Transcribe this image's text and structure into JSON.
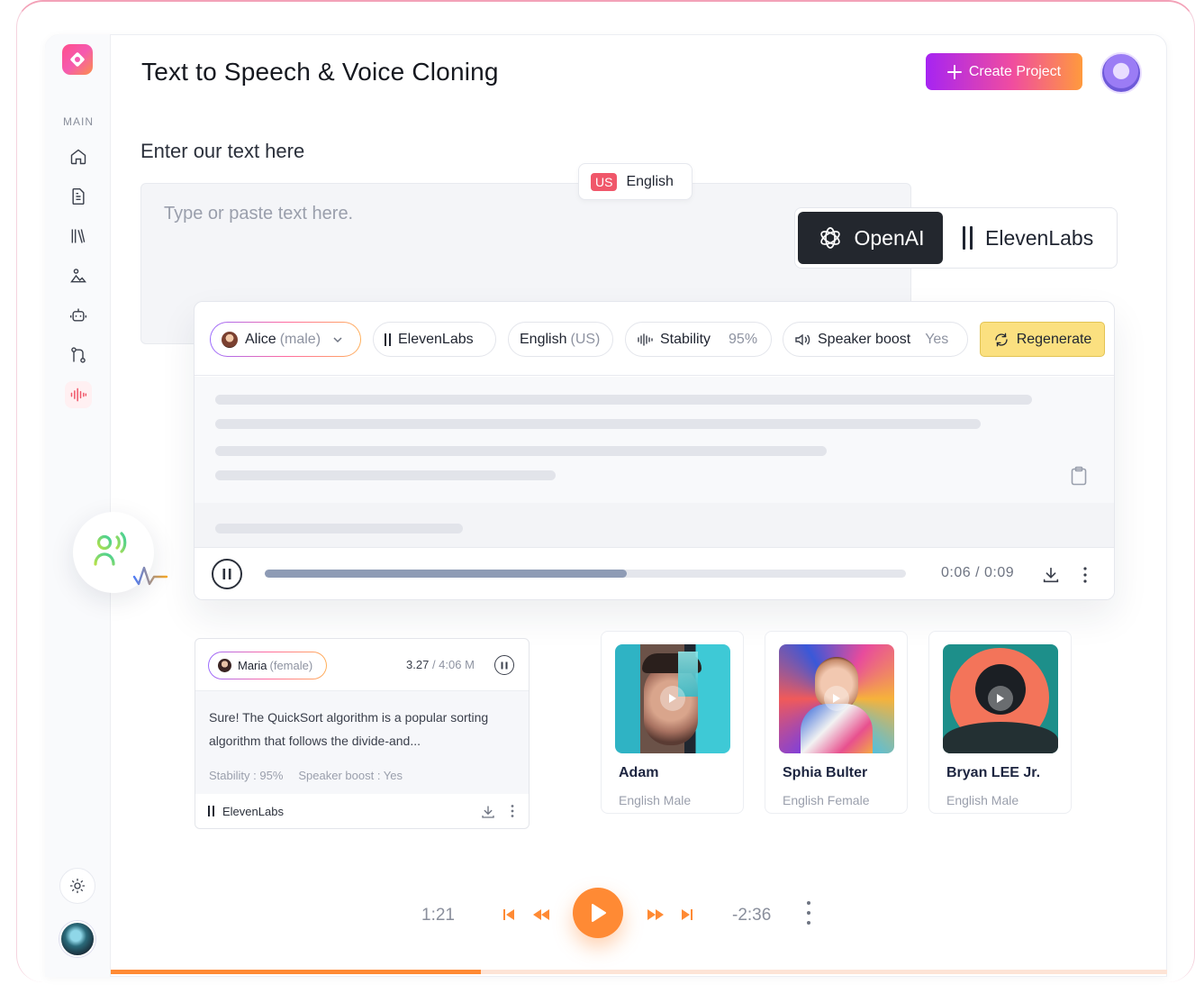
{
  "app": {
    "title": "Text to Speech & Voice Cloning",
    "create_label": "Create Project"
  },
  "sidebar": {
    "section_label": "MAIN",
    "items": [
      {
        "icon": "home-icon"
      },
      {
        "icon": "document-icon"
      },
      {
        "icon": "library-icon"
      },
      {
        "icon": "image-icon"
      },
      {
        "icon": "robot-icon"
      },
      {
        "icon": "git-merge-icon"
      },
      {
        "icon": "waveform-icon",
        "active": true
      }
    ]
  },
  "editor": {
    "heading": "Enter our text here",
    "language_flag": "US",
    "language": "English",
    "placeholder": "Type or paste text here."
  },
  "providers": {
    "openai": "OpenAI",
    "elevenlabs": "ElevenLabs",
    "selected": "OpenAI"
  },
  "settings": {
    "voice_name": "Alice",
    "voice_gender": "(male)",
    "provider": "ElevenLabs",
    "language": "English",
    "language_region": "(US)",
    "stability_label": "Stability",
    "stability_value": "95%",
    "speaker_boost_label": "Speaker boost",
    "speaker_boost_value": "Yes",
    "regenerate_label": "Regenerate"
  },
  "player": {
    "time": "0:06 / 0:09",
    "progress": 0.565
  },
  "history": {
    "voice_name": "Maria",
    "voice_gender": "(female)",
    "size": "3.27",
    "duration": "/ 4:06 M",
    "text": "Sure! The QuickSort algorithm is a popular sorting algorithm that follows the divide-and...",
    "stability": "Stability : 95%",
    "speaker_boost": "Speaker boost : Yes",
    "provider": "ElevenLabs"
  },
  "voices": [
    {
      "name": "Adam",
      "desc": "English Male"
    },
    {
      "name": "Sphia Bulter",
      "desc": "English Female"
    },
    {
      "name": "Bryan LEE Jr.",
      "desc": "English Male"
    }
  ],
  "bottom_player": {
    "elapsed": "1:21",
    "remaining": "-2:36",
    "progress": 0.35,
    "accent": "#ff8a34"
  }
}
